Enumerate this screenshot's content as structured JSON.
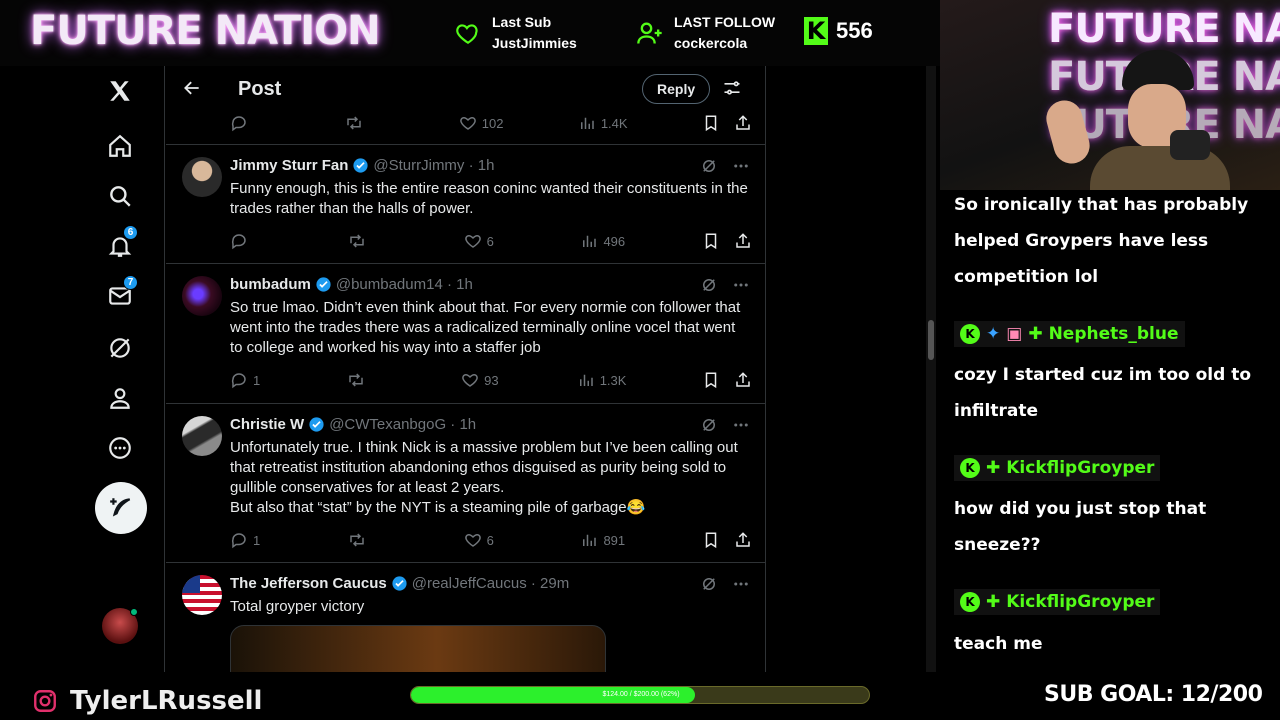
{
  "overlay": {
    "brand": "FUTURE NATION",
    "last_sub_label": "Last Sub",
    "last_sub_name": "JustJimmies",
    "last_follow_label": "LAST FOLLOW",
    "last_follow_name": "cockercola",
    "kick_count": "556",
    "accent": "#53fc18"
  },
  "nav": {
    "notifications_badge": "6",
    "messages_badge": "7"
  },
  "header": {
    "title": "Post",
    "reply_label": "Reply"
  },
  "top_actions": {
    "replies": "",
    "likes": "102",
    "views": "1.4K"
  },
  "tweets": [
    {
      "name": "Jimmy Sturr Fan",
      "handle": "@SturrJimmy · 1h",
      "text": "Funny enough, this is the entire reason coninc wanted their constituents in the trades rather than the halls of power.",
      "replies": "",
      "likes": "6",
      "views": "496"
    },
    {
      "name": "bumbadum",
      "handle": "@bumbadum14 · 1h",
      "text": "So true lmao. Didn’t even think about that. For every normie con follower that went into the trades there was a radicalized terminally online vocel that went to college and worked his way into a staffer job",
      "replies": "1",
      "likes": "93",
      "views": "1.3K"
    },
    {
      "name": "Christie W",
      "handle": "@CWTexanbgoG · 1h",
      "text": "Unfortunately true. I think Nick is a massive problem but I’ve been calling out that retreatist institution abandoning ethos disguised as purity being sold to gullible conservatives for at least 2 years.",
      "text2": "But also that “stat” by the NYT is a steaming pile of garbage😂",
      "replies": "1",
      "likes": "6",
      "views": "891"
    },
    {
      "name": "The Jefferson Caucus",
      "handle": "@realJeffCaucus · 29m",
      "text": "Total groyper victory"
    }
  ],
  "chat": {
    "msg1": "So ironically that has probably helped Groypers have less competition lol",
    "user2": "Nephets_blue",
    "msg2": "cozy I started cuz im too old to infiltrate",
    "user3": "KickflipGroyper",
    "msg3": "how did you just stop that sneeze??",
    "user4": "KickflipGroyper",
    "msg4": "teach me"
  },
  "webcam": {
    "neon_text": "FUTURE NATION"
  },
  "bottom": {
    "handle": "TylerLRussell",
    "goal_text": "$124.00 / $200.00 (62%)",
    "goal_progress": 0.62,
    "sub_goal": "SUB GOAL: 12/200"
  }
}
